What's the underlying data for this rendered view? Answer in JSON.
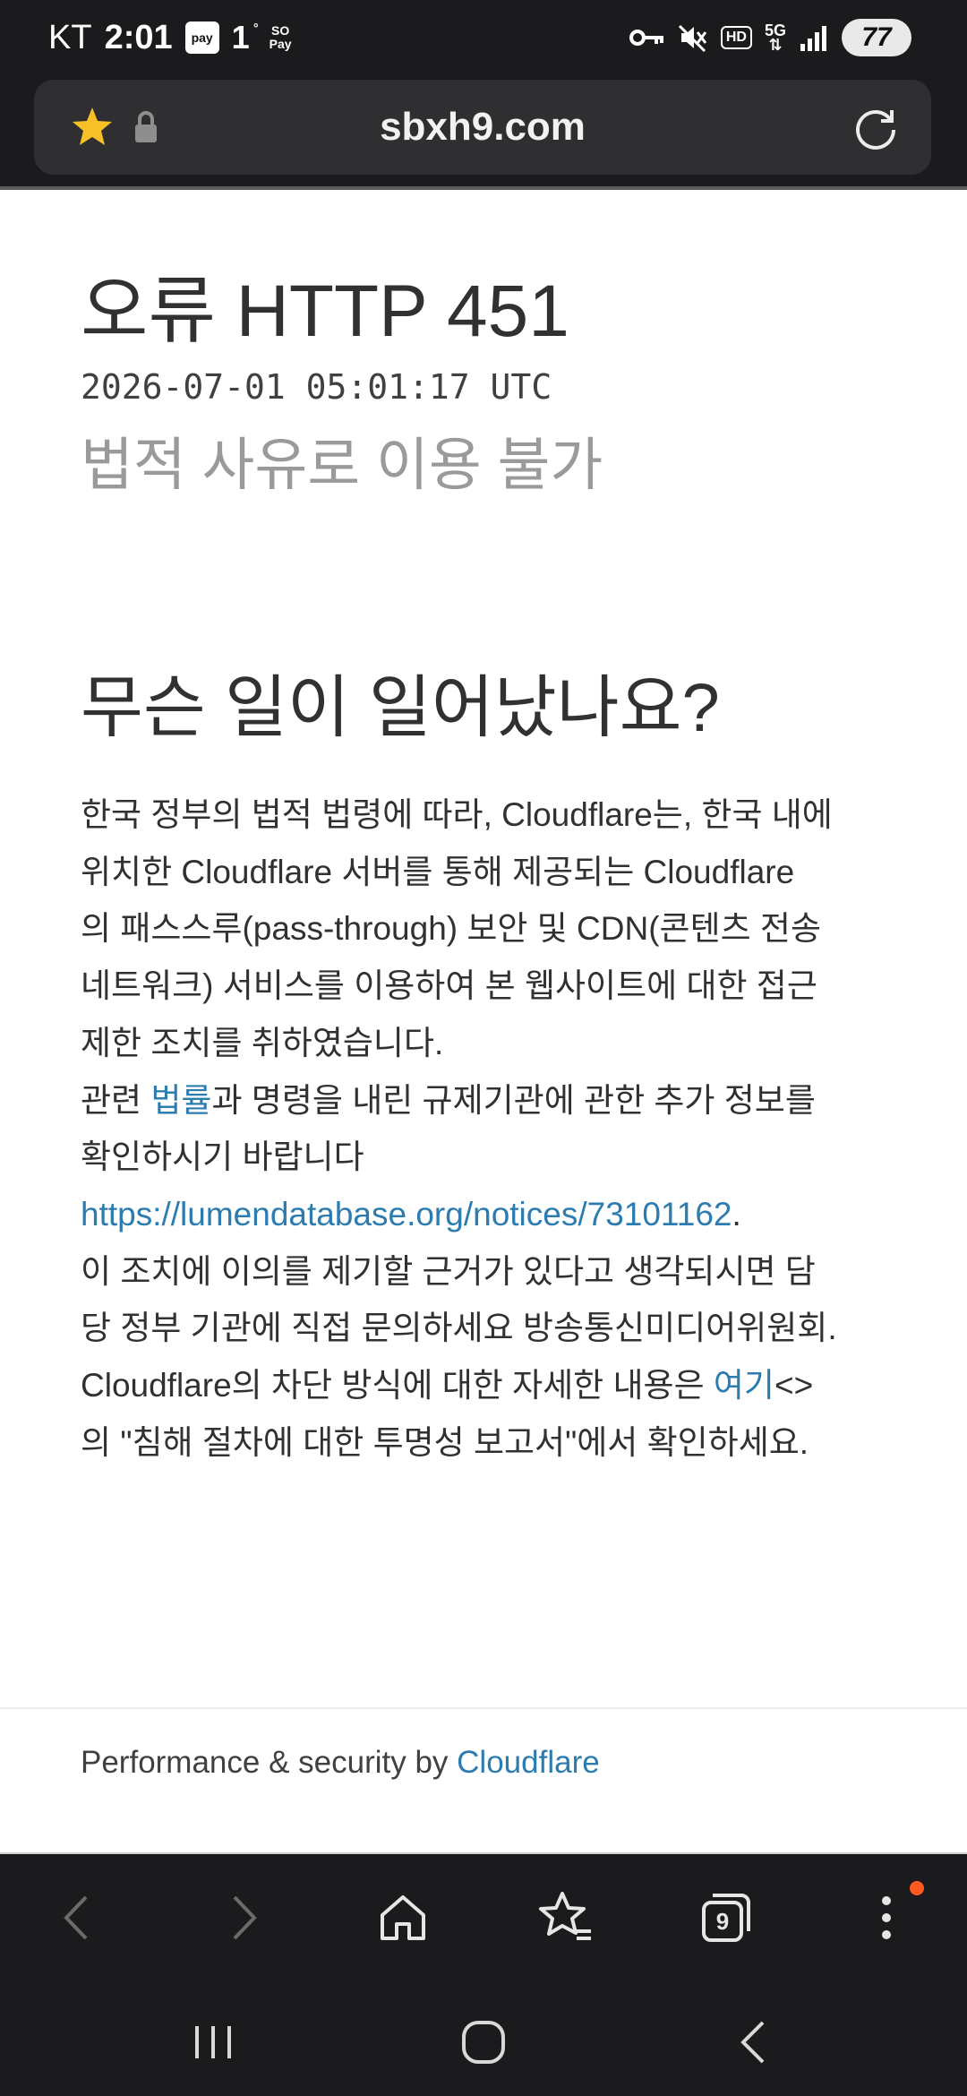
{
  "status_bar": {
    "carrier": "KT",
    "time": "2:01",
    "pay_label": "pay",
    "temperature": "1",
    "temperature_unit": "°",
    "sopay_label_top": "SO",
    "sopay_label_bottom": "Pay",
    "hd_label": "HD",
    "network_label": "5G",
    "battery_level": "77"
  },
  "browser": {
    "url": "sbxh9.com",
    "tab_count": "9"
  },
  "page": {
    "title": "오류 HTTP 451",
    "timestamp": "2026-07-01 05:01:17 UTC",
    "subtitle": "법적 사유로 이용 불가",
    "heading": "무슨 일이 일어났나요?",
    "paragraph_lines": [
      "한국 정부의 법적 법령에 따라, Cloudflare는, 한국 내에",
      "위치한 Cloudflare 서버를 통해 제공되는 Cloudflare",
      "의 패스스루(pass-through) 보안 및 CDN(콘텐츠 전송",
      "네트워크) 서비스를 이용하여 본 웹사이트에 대한 접근",
      "제한 조치를 취하였습니다."
    ],
    "law_line_prefix": "관련 ",
    "law_link": "법률",
    "law_line_suffix": "과 명령을 내린 규제기관에 관한 추가 정보를",
    "confirm_line": "확인하시기 바랍니다",
    "notice_url": "https://lumendatabase.org/notices/73101162",
    "notice_url_suffix": ".",
    "appeal_lines": [
      "이 조치에 이의를 제기할 근거가 있다고 생각되시면 담",
      "당 정부 기관에 직접 문의하세요 방송통신미디어위원회."
    ],
    "block_line_prefix": "Cloudflare의 차단 방식에 대한 자세한 내용은 ",
    "here_link": "여기",
    "block_line_suffix": "<>",
    "last_line": "의 \"침해 절차에 대한 투명성 보고서\"에서 확인하세요."
  },
  "footer": {
    "text": "Performance & security by ",
    "link": "Cloudflare"
  },
  "colors": {
    "link": "#2c7cb0",
    "chrome_background": "#1b1b1d",
    "urlbar_background": "#2f2f32",
    "star": "#f6c026",
    "notification_dot": "#ff5a1f"
  }
}
